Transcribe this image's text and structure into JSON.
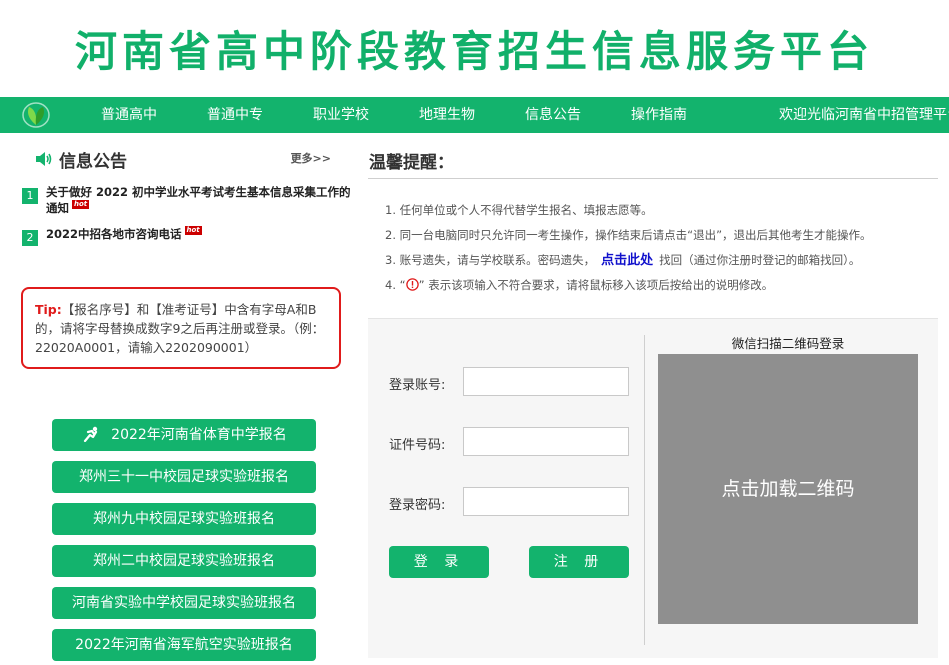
{
  "header": {
    "title": "河南省高中阶段教育招生信息服务平台"
  },
  "nav": {
    "items": [
      "普通高中",
      "普通中专",
      "职业学校",
      "地理生物",
      "信息公告",
      "操作指南"
    ],
    "welcome": "欢迎光临河南省中招管理平台"
  },
  "notices": {
    "title": "信息公告",
    "more": "更多>>",
    "items": [
      {
        "num": "1",
        "text": "关于做好 2022 初中学业水平考试考生基本信息采集工作的通知",
        "badge": "hot"
      },
      {
        "num": "2",
        "text": "2022中招各地市咨询电话",
        "badge": "hot"
      }
    ]
  },
  "tip": {
    "label": "Tip:",
    "text": "【报名序号】和【准考证号】中含有字母A和B的，请将字母替换成数字9之后再注册或登录。（例：22020A0001，请输入2202090001）"
  },
  "registration_buttons": [
    "2022年河南省体育中学报名",
    "郑州三十一中校园足球实验班报名",
    "郑州九中校园足球实验班报名",
    "郑州二中校园足球实验班报名",
    "河南省实验中学校园足球实验班报名",
    "2022年河南省海军航空实验班报名"
  ],
  "reminder": {
    "heading": "温馨提醒：",
    "item1": "1. 任何单位或个人不得代替学生报名、填报志愿等。",
    "item2": "2. 同一台电脑同时只允许同一考生操作，操作结束后请点击“退出”，退出后其他考生才能操作。",
    "item3_before": "3. 账号遗失，请与学校联系。密码遗失，",
    "item3_link": "点击此处",
    "item3_after": "找回（通过你注册时登记的邮箱找回）。",
    "item4_before": "4. “",
    "item4_after": "” 表示该项输入不符合要求，请将鼠标移入该项后按给出的说明修改。"
  },
  "login": {
    "account_label": "登录账号:",
    "account_value": "",
    "id_label": "证件号码:",
    "id_value": "",
    "password_label": "登录密码:",
    "password_value": "",
    "login_button": "登 录",
    "register_button": "注 册"
  },
  "qr": {
    "title": "微信扫描二维码登录",
    "placeholder": "点击加载二维码"
  },
  "colors": {
    "brand_green": "#13b36d",
    "title_green": "#11b06a",
    "alert_red": "#e01b1b",
    "link_blue": "#1111cc"
  }
}
